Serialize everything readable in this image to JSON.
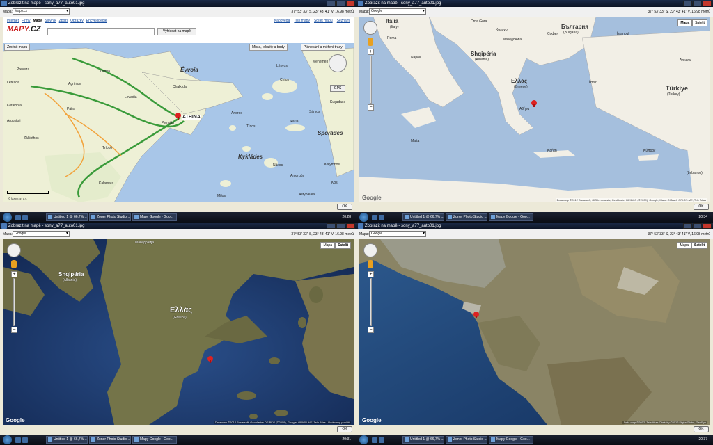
{
  "common": {
    "window_title": "Zobrazit na mapě - sony_a77_auto01.jpg",
    "map_label": "Mapa:",
    "coords": "37° 53' 33\" S, 23° 43' 41\" V, 16.98 metrů",
    "ok_label": "OK"
  },
  "q1": {
    "map_select": "Mapy.cz",
    "nav": [
      "Internet",
      "Firmy",
      "Mapy",
      "Slovník",
      "Zboží",
      "Obrázky",
      "Encyklopedie"
    ],
    "nav_active": "Mapy",
    "nav_right": [
      "Nápověda",
      "Tisk mapy",
      "Sdílet mapu",
      "Seznam"
    ],
    "logo_main": "MAPY",
    "logo_suffix": ".CZ",
    "search_placeholder": "",
    "search_button": "Vyhledat na mapě",
    "change_map": "Změnit mapu",
    "places_button": "Místa, lokality a body",
    "route_button": "Plánování a měření trasy",
    "gps": "GPS",
    "copyright": "© Mapy.cz, a.s.",
    "labels": {
      "preveza": "Preveza",
      "lamia": "Lamía",
      "agrinion": "Agrinion",
      "levadia": "Levadia",
      "chalkida": "Chalkída",
      "evvoia": "Évvoia",
      "patra": "Pátra",
      "athina": "ATHINA",
      "peiraias": "Peiraiás",
      "tripoli": "Trípoli",
      "kalamata": "Kalamata",
      "zakinthos": "Zákinthos",
      "kyklades": "Kykládes",
      "andros": "Ándros",
      "tinos": "Tínos",
      "naxos": "Náxos",
      "sporades": "Sporádes",
      "kalymnos": "Kálymnos",
      "milos": "Mílos",
      "kos": "Kos",
      "lesvos": "Lésvos",
      "chios": "Chíos",
      "samos": "Sámos",
      "ikaria": "Ikaría",
      "kusadasi": "Kuşadası",
      "menemen": "Menemen",
      "amorgos": "Amorgós",
      "astypalaia": "Astypálaia",
      "kefalonia": "Kefalonia",
      "argostoli": "Argostoli",
      "lefkada": "Lefkáda"
    }
  },
  "q2": {
    "map_select": "Google",
    "map_types": [
      "Mapa",
      "Satelit"
    ],
    "active_type": "Mapa",
    "copyright": "Data map ©2012 Basarsoft, GIS Innovatsia, Geoblaster DE/BKG (©2009), Google, Mapa GISrael, ORION-ME, Tele Atlas",
    "labels": {
      "italia": "Italia",
      "italia_en": "(Italy)",
      "bulgaria": "България",
      "bulgaria_en": "(Bulgaria)",
      "shqiperia": "Shqipëria",
      "shqiperia_en": "(Albania)",
      "ellas": "Ελλάς",
      "ellas_en": "(Greece)",
      "turkiye": "Türkiye",
      "turkiye_en": "(Turkey)",
      "roma": "Roma",
      "napoli": "Napoli",
      "sofia": "София",
      "athina": "Αθήνα",
      "istanbul": "İstanbul",
      "ankara": "Ankara",
      "malta": "Malta",
      "kriti": "Κρήτη",
      "kypros": "Κύπρος",
      "lebanon": "(Lebanon)",
      "kosovo": "Kosovo",
      "makedonija": "Македонија",
      "crna_gora": "Crna Gora",
      "izmir": "İzmir"
    }
  },
  "q3": {
    "map_select": "Google",
    "map_types": [
      "Mapa",
      "Satelit"
    ],
    "active_type": "Satelit",
    "copyright": "Data map ©2012 Basarsoft, Geoblaster DE/BKG (©2009), Google, ORION-ME, Tele Atlas - Podmínky použití",
    "labels": {
      "ellas": "Ελλάς",
      "ellas_en": "(Greece)",
      "shqiperia": "Shqipëria",
      "shqiperia_en": "(Albania)",
      "makedonija": "Македонија"
    }
  },
  "q4": {
    "map_select": "Google",
    "map_types": [
      "Mapa",
      "Satelit"
    ],
    "active_type": "Satelit",
    "copyright": "Data map ©2012, Tele Atlas Obrázky ©2012 DigitalGlobe, GeoEye"
  },
  "taskbars": {
    "q1": {
      "items": [
        "Untitled 1 @ 66,7% ...",
        "Zoner Photo Studio ...",
        "Mapy Google - Goo..."
      ],
      "time": "20:28"
    },
    "q2": {
      "items": [
        "Untitled 1 @ 66,7% ...",
        "Zoner Photo Studio ...",
        "Mapy Google - Goo..."
      ],
      "time": "20:34"
    },
    "q3": {
      "items": [
        "Untitled 1 @ 66,7% ...",
        "Zoner Photo Studio ...",
        "Mapy Google - Goo..."
      ],
      "time": "20:31"
    },
    "q4": {
      "items": [
        "Untitled 1 @ 66,7% ...",
        "Zoner Photo Studio ...",
        "Mapy Google - Goo..."
      ],
      "time": "20:37"
    }
  },
  "colors": {
    "sea_map": "#a8c6e8",
    "land_map": "#eef0d6",
    "sea_sat": "#1f3f76",
    "land_sat": "#6b6a45",
    "pin": "#dd2222"
  }
}
